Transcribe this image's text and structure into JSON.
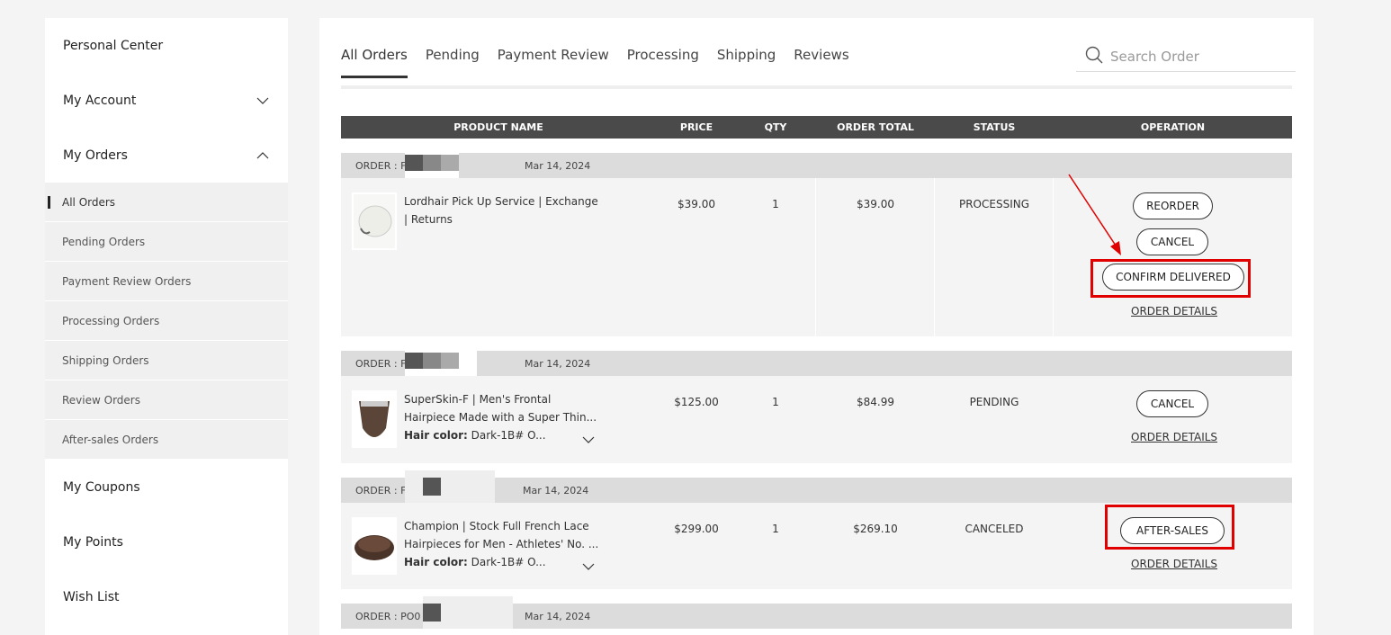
{
  "sidebar": {
    "personal_center": "Personal Center",
    "my_account": "My Account",
    "my_orders": "My Orders",
    "orders_submenu": [
      "All Orders",
      "Pending Orders",
      "Payment Review Orders",
      "Processing Orders",
      "Shipping Orders",
      "Review Orders",
      "After-sales Orders"
    ],
    "my_coupons": "My Coupons",
    "my_points": "My Points",
    "wish_list": "Wish List"
  },
  "tabs": [
    "All Orders",
    "Pending",
    "Payment Review",
    "Processing",
    "Shipping",
    "Reviews"
  ],
  "active_tab": "All Orders",
  "search": {
    "placeholder": "Search Order"
  },
  "table_headers": [
    "PRODUCT NAME",
    "PRICE",
    "QTY",
    "ORDER TOTAL",
    "STATUS",
    "OPERATION"
  ],
  "orders": [
    {
      "order_label": "ORDER : F",
      "date": "Mar 14, 2024",
      "product_name": "Lordhair Pick Up Service | Exchange | Returns",
      "attr_label": "",
      "attr_value": "",
      "price": "$39.00",
      "qty": "1",
      "total": "$39.00",
      "status": "PROCESSING",
      "buttons": [
        "REORDER",
        "CANCEL",
        "CONFIRM DELIVERED"
      ],
      "details_link": "ORDER DETAILS"
    },
    {
      "order_label": "ORDER : F",
      "date": "Mar 14, 2024",
      "product_name": "SuperSkin-F | Men's Frontal Hairpiece Made with a Super Thin...",
      "attr_label": "Hair color:",
      "attr_value": "Dark-1B# O...",
      "price": "$125.00",
      "qty": "1",
      "total": "$84.99",
      "status": "PENDING",
      "buttons": [
        "CANCEL"
      ],
      "details_link": "ORDER DETAILS"
    },
    {
      "order_label": "ORDER : F",
      "date": "Mar 14, 2024",
      "product_name": "Champion | Stock Full French Lace Hairpieces for Men - Athletes' No. ...",
      "attr_label": "Hair color:",
      "attr_value": "Dark-1B# O...",
      "price": "$299.00",
      "qty": "1",
      "total": "$269.10",
      "status": "CANCELED",
      "buttons": [
        "AFTER-SALES"
      ],
      "details_link": "ORDER DETAILS"
    },
    {
      "order_label": "ORDER : PO0",
      "date": "Mar 14, 2024"
    }
  ],
  "colors": {
    "header_bg": "#4a4a4a",
    "order_bar": "#dcdcdc",
    "highlight": "#e00000"
  }
}
